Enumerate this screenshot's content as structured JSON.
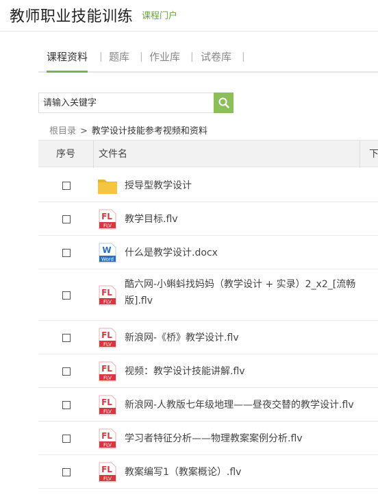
{
  "header": {
    "title": "教师职业技能训练",
    "portal_link": "课程门户"
  },
  "tabs": [
    {
      "label": "课程资料",
      "active": true
    },
    {
      "label": "题库",
      "active": false
    },
    {
      "label": "作业库",
      "active": false
    },
    {
      "label": "试卷库",
      "active": false
    }
  ],
  "tab_separator": "|",
  "search": {
    "placeholder": "请输入关键字",
    "icon": "search-icon"
  },
  "breadcrumb": {
    "root": "根目录",
    "separator": ">",
    "current": "教学设计技能参考视频和资料"
  },
  "table": {
    "columns": [
      "序号",
      "文件名",
      "下"
    ],
    "rows": [
      {
        "type": "folder",
        "name": "授导型教学设计"
      },
      {
        "type": "flv",
        "name": "教学目标.flv"
      },
      {
        "type": "docx",
        "name": "什么是教学设计.docx"
      },
      {
        "type": "flv",
        "name": "酷六网-小蝌蚪找妈妈（教学设计 + 实录）2_x2_[流畅版].flv"
      },
      {
        "type": "flv",
        "name": "新浪网-《桥》教学设计.flv"
      },
      {
        "type": "flv",
        "name": "视频：教学设计技能讲解.flv"
      },
      {
        "type": "flv",
        "name": "新浪网-人教版七年级地理——昼夜交替的教学设计.flv"
      },
      {
        "type": "flv",
        "name": "学习者特征分析——物理教案案例分析.flv"
      },
      {
        "type": "flv",
        "name": "教案编写1（教案概论）.flv"
      }
    ]
  },
  "icon_text": {
    "flv_top": "FL",
    "flv_bottom": "FLV",
    "word_top": "W",
    "word_bottom": "Word"
  },
  "colors": {
    "accent": "#7ab24a",
    "portal_link": "#6aa33c",
    "search_button": "#8cbf5a",
    "flv_red": "#d9363e",
    "folder": "#f5c542",
    "word_blue": "#2b6fc4"
  }
}
